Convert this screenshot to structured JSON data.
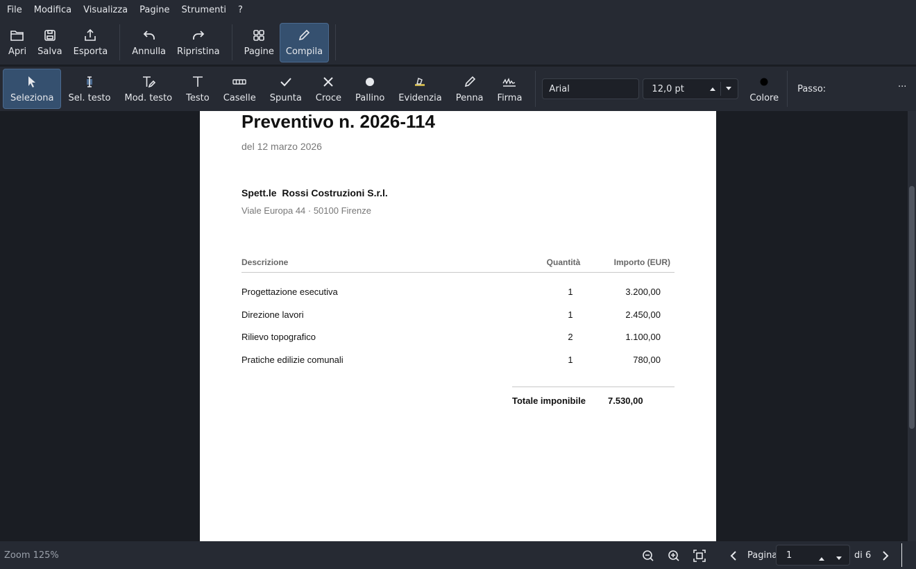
{
  "menu": [
    "File",
    "Modifica",
    "Visualizza",
    "Pagine",
    "Strumenti",
    "?"
  ],
  "toolbar_main": {
    "open": "Apri",
    "save": "Salva",
    "export": "Esporta",
    "undo": "Annulla",
    "redo": "Ripristina",
    "pages": "Pagine",
    "fill": "Compila"
  },
  "toolbar_tools": {
    "select": "Seleziona",
    "select_text": "Sel. testo",
    "edit_text": "Mod. testo",
    "text": "Testo",
    "boxes": "Caselle",
    "check": "Spunta",
    "cross": "Croce",
    "dot": "Pallino",
    "highlight": "Evidenzia",
    "pen": "Penna",
    "sign": "Firma",
    "font_value": "Arial",
    "size_value": "12,0 pt",
    "color_label": "Colore",
    "step_label": "Passo:",
    "more": "···"
  },
  "document": {
    "title": "Preventivo n. 2026-114",
    "date": "del 12 marzo 2026",
    "client": "Spett.le  Rossi Costruzioni S.r.l.",
    "address": "Viale Europa 44 · 50100 Firenze",
    "headers": {
      "desc": "Descrizione",
      "qty": "Quantità",
      "amount": "Importo (EUR)"
    },
    "rows": [
      {
        "desc": "Progettazione esecutiva",
        "qty": "1",
        "amount": "3.200,00"
      },
      {
        "desc": "Direzione lavori",
        "qty": "1",
        "amount": "2.450,00"
      },
      {
        "desc": "Rilievo topografico",
        "qty": "2",
        "amount": "1.100,00"
      },
      {
        "desc": "Pratiche edilizie comunali",
        "qty": "1",
        "amount": "780,00"
      }
    ],
    "total_label": "Totale imponibile",
    "total_value": "7.530,00"
  },
  "status": {
    "zoom": "Zoom 125%",
    "page_label": "Pagina",
    "page_value": "1",
    "page_of": "di 6"
  },
  "colors": {
    "active_bg": "#35506f",
    "bg": "#262a33",
    "canvas": "#1a1d23"
  }
}
